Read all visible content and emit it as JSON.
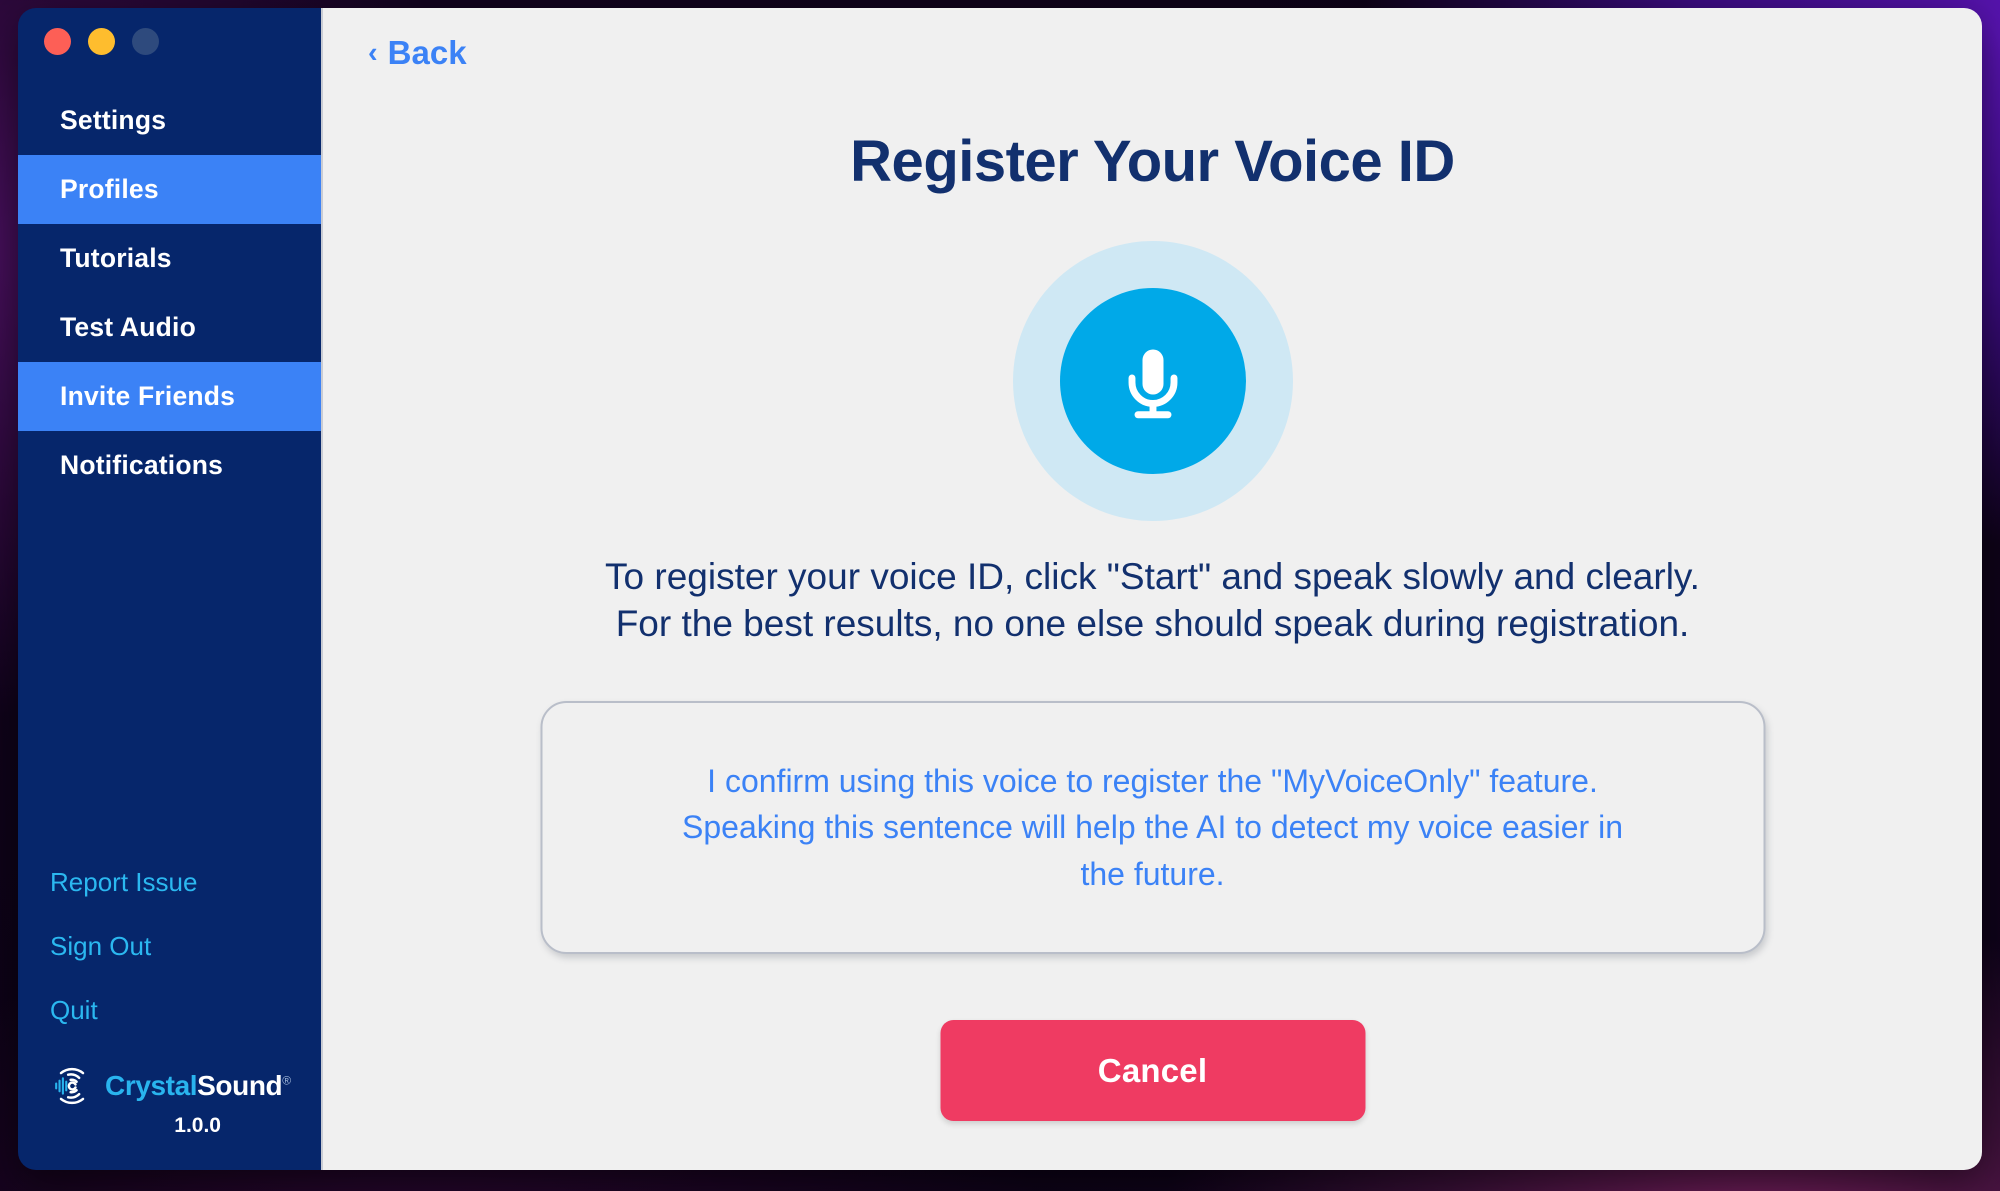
{
  "window": {
    "traffic_lights": [
      {
        "name": "close",
        "color": "#fd5f56"
      },
      {
        "name": "minimize",
        "color": "#febd2e"
      },
      {
        "name": "zoom",
        "color": "#2e4a7d"
      }
    ]
  },
  "sidebar": {
    "nav_items": [
      {
        "label": "Settings",
        "active": false
      },
      {
        "label": "Profiles",
        "active": true
      },
      {
        "label": "Tutorials",
        "active": false
      },
      {
        "label": "Test Audio",
        "active": false
      },
      {
        "label": "Invite Friends",
        "active": true
      },
      {
        "label": "Notifications",
        "active": false
      }
    ],
    "footer_links": [
      {
        "label": "Report Issue"
      },
      {
        "label": "Sign Out"
      },
      {
        "label": "Quit"
      }
    ],
    "brand": {
      "name_part1": "Crystal",
      "name_part2": "Sound",
      "registered_mark": "®",
      "version": "1.0.0",
      "logo_icon": "crystalsound-logo-icon"
    },
    "colors": {
      "background": "#06266b",
      "active_item": "#3b82f6",
      "link": "#2bb8f0",
      "brand_accent": "#29b4ee"
    }
  },
  "content": {
    "back": {
      "icon": "chevron-left-icon",
      "chevron": "‹",
      "label": "Back"
    },
    "title": "Register Your Voice ID",
    "mic": {
      "icon": "microphone-icon",
      "halo_color": "#cfe8f4",
      "circle_color": "#00a9e8"
    },
    "instructions": {
      "line1": "To register your voice ID, click \"Start\" and speak slowly and clearly.",
      "line2": "For the best results, no one else should speak during registration."
    },
    "confirm_card": {
      "line1": "I confirm using this voice to register the \"MyVoiceOnly\" feature.",
      "line2": "Speaking this sentence will help the AI to detect my voice easier in",
      "line3": "the future.",
      "text_color": "#3b82f6",
      "border_color": "#b9bec9"
    },
    "cancel_button": {
      "label": "Cancel",
      "color": "#ef3b62"
    },
    "colors": {
      "background": "#f0f0f0",
      "title": "#12306e",
      "link": "#3b82f6"
    }
  }
}
